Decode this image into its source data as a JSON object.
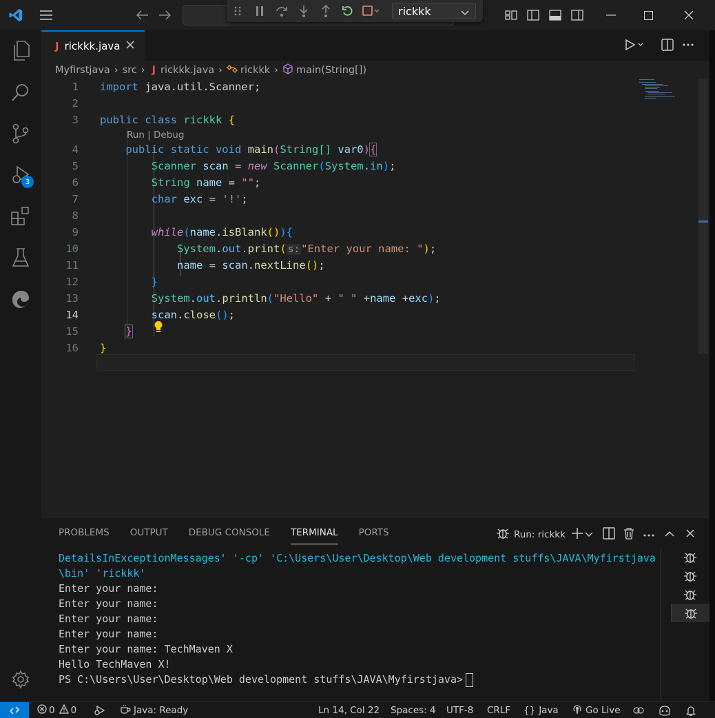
{
  "titlebar": {
    "debug_config": "rickkk",
    "nav_back": "back-arrow-icon",
    "nav_forward": "forward-arrow-icon"
  },
  "activity": {
    "debug_badge": "3"
  },
  "editor": {
    "tab": {
      "icon_letter": "J",
      "name": "rickkk.java"
    },
    "breadcrumb": {
      "project": "Myfirstjava",
      "folder": "src",
      "file_icon": "J",
      "file": "rickkk.java",
      "class": "rickkk",
      "method": "main(String[])"
    },
    "codelens": "Run | Debug",
    "line_numbers": [
      "1",
      "2",
      "3",
      "4",
      "5",
      "6",
      "7",
      "8",
      "9",
      "10",
      "11",
      "12",
      "13",
      "14",
      "15",
      "16"
    ],
    "code": {
      "l1_kw": "import",
      "l1_rest": " java.util.Scanner;",
      "l3_kw1": "public",
      "l3_kw2": "class",
      "l3_name": "rickkk",
      "l3_brace": "{",
      "l4_kw": "public static void",
      "l4_fn": "main",
      "l4_param_type": "String[]",
      "l4_param": " var0",
      "l5_type": "Scanner",
      "l5_var": "scan",
      "l5_new": "new",
      "l5_cls": "Scanner",
      "l5_sys": "System",
      "l5_in": "in",
      "l6_type": "String",
      "l6_var": "name",
      "l6_str": "\"\"",
      "l7_type": "char",
      "l7_var": "exc",
      "l7_str": "'!'",
      "l9_kw": "while",
      "l9_var": "name",
      "l9_fn": "isBlank",
      "l10_sys": "System",
      "l10_out": "out",
      "l10_fn": "print",
      "l10_hint": "s:",
      "l10_str": "\"Enter your name: \"",
      "l11_var": "name",
      "l11_scan": "scan",
      "l11_fn": "nextLine",
      "l13_sys": "System",
      "l13_out": "out",
      "l13_fn": "println",
      "l13_str1": "\"Hello\"",
      "l13_str2": "\" \"",
      "l13_var1": "name",
      "l13_var2": "exc",
      "l14_scan": "scan",
      "l14_fn": "close"
    }
  },
  "panel": {
    "tabs": [
      "PROBLEMS",
      "OUTPUT",
      "DEBUG CONSOLE",
      "TERMINAL",
      "PORTS"
    ],
    "terminal_name": "Run: rickkk",
    "terminal_lines": [
      "DetailsInExceptionMessages' '-cp' 'C:\\Users\\User\\Desktop\\Web development stuffs\\JAVA\\Myfirstjava",
      "\\bin' 'rickkk'",
      "Enter your name:",
      "Enter your name:",
      "Enter your name:",
      "Enter your name:",
      "Enter your name: TechMaven X",
      "Hello TechMaven X!",
      "PS C:\\Users\\User\\Desktop\\Web development stuffs\\JAVA\\Myfirstjava>"
    ]
  },
  "status": {
    "errors": "0",
    "warnings": "0",
    "java": "Java: Ready",
    "position": "Ln 14, Col 22",
    "spaces": "Spaces: 4",
    "encoding": "UTF-8",
    "eol": "CRLF",
    "language": "Java",
    "golive": "Go Live"
  }
}
